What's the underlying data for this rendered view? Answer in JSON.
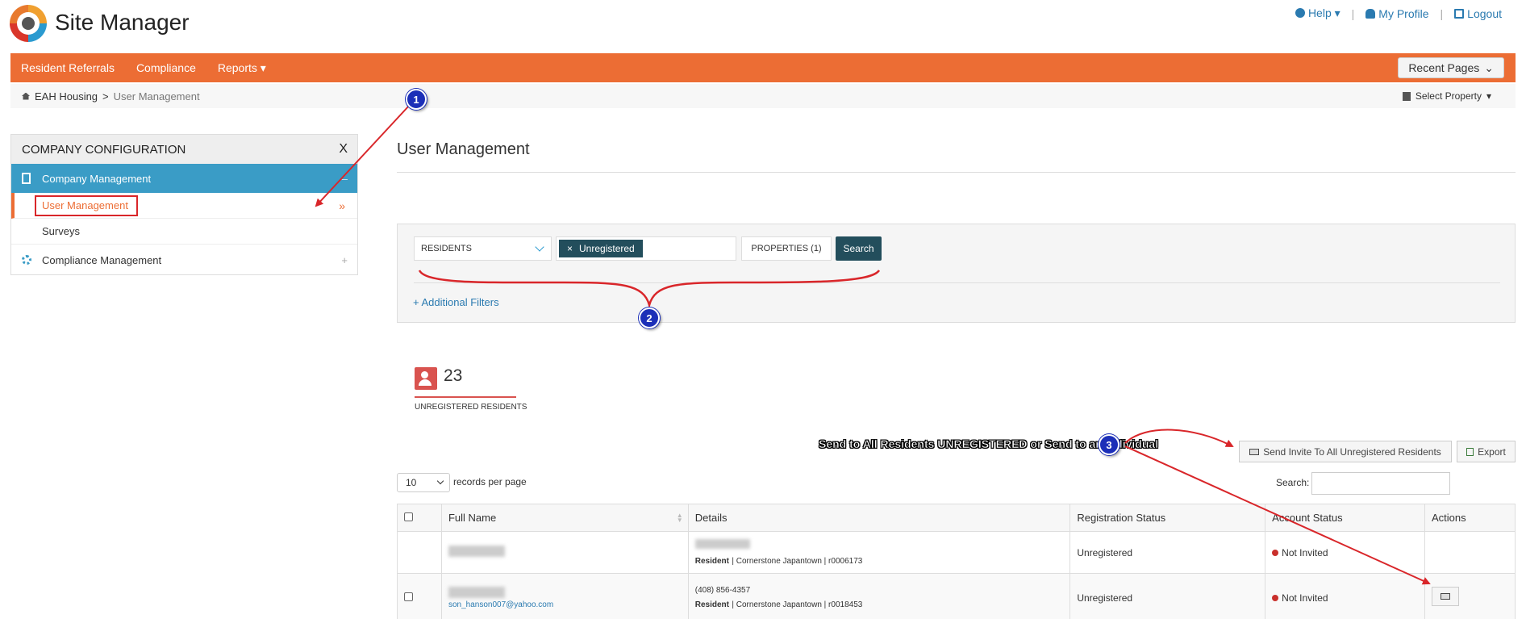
{
  "header": {
    "app_title": "Site Manager",
    "help": "Help",
    "profile": "My Profile",
    "logout": "Logout",
    "separator": "|"
  },
  "nav": {
    "items": [
      "Resident Referrals",
      "Compliance",
      "Reports"
    ],
    "recent_pages": "Recent Pages"
  },
  "breadcrumb": {
    "home": "EAH Housing",
    "separator": ">",
    "current": "User Management",
    "select_property": "Select Property"
  },
  "sidebar": {
    "heading": "COMPANY CONFIGURATION",
    "close": "X",
    "company_management": "Company Management",
    "collapse": "–",
    "user_management": "User Management",
    "surveys": "Surveys",
    "compliance_management": "Compliance Management",
    "expand": "+",
    "chevron": "»"
  },
  "main": {
    "title": "User Management",
    "filters": {
      "type_select": "RESIDENTS",
      "tag": "Unregistered",
      "tag_remove": "×",
      "properties": "PROPERTIES (1)",
      "search": "Search",
      "additional_filters": "+ Additional Filters"
    },
    "summary": {
      "count": "23",
      "label": "UNREGISTERED RESIDENTS"
    },
    "callout_text": "Send to All Residents UNREGISTERED or Send to an Individual",
    "buttons": {
      "send_invite_all": "Send Invite To All Unregistered Residents",
      "export": "Export"
    },
    "paging": {
      "page_size": "10",
      "records_per_page": "records per page",
      "search_label": "Search:"
    },
    "table": {
      "headers": [
        "Full Name",
        "Details",
        "Registration Status",
        "Account Status",
        "Actions"
      ],
      "rows": [
        {
          "email": "",
          "phone": "",
          "details_role": "Resident",
          "details_rest": "| Cornerstone Japantown | r0006173",
          "registration": "Unregistered",
          "account": "Not Invited"
        },
        {
          "email": "son_hanson007@yahoo.com",
          "phone": "(408) 856-4357",
          "details_role": "Resident",
          "details_rest": "| Cornerstone Japantown | r0018453",
          "registration": "Unregistered",
          "account": "Not Invited"
        }
      ]
    }
  },
  "annotations": {
    "badge_1": "1",
    "badge_2": "2",
    "badge_3": "3"
  },
  "colors": {
    "brand_orange": "#ec6d34",
    "sidebar_blue": "#3a9cc6",
    "dark_teal": "#234e5c",
    "annotation_red": "#d9262a",
    "badge_blue": "#1c2fb8"
  }
}
